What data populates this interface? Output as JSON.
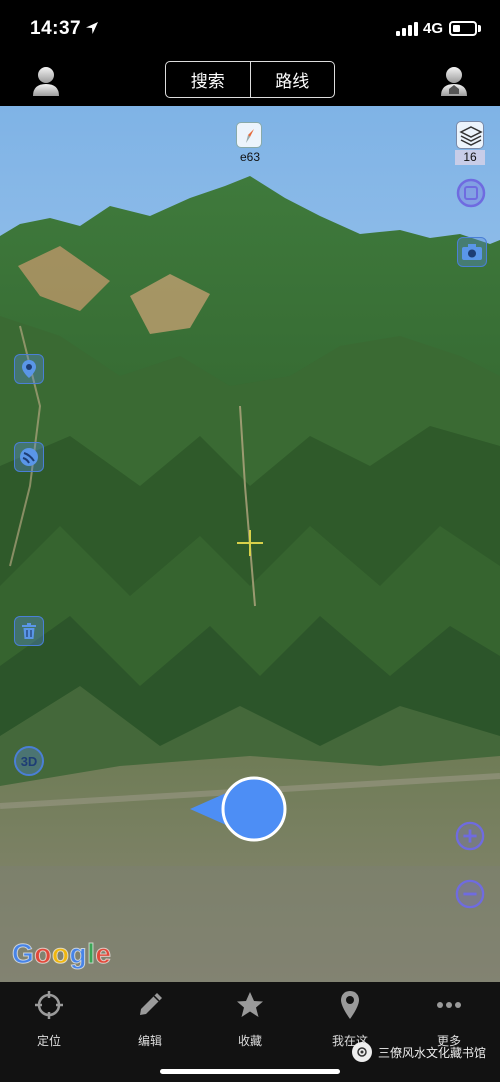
{
  "status_bar": {
    "time": "14:37",
    "network": "4G",
    "location_icon": "location-arrow-icon",
    "signal_icon": "cellular-signal-icon",
    "battery_icon": "battery-low-icon",
    "battery_level": 0.25
  },
  "top_nav": {
    "left_icon": "user-profile-icon",
    "right_icon": "user-home-icon",
    "segments": [
      "搜索",
      "路线"
    ]
  },
  "map": {
    "compass_label": "e63",
    "zoom_level": "16",
    "crosshair_icon": "crosshair-icon",
    "left_tools": [
      {
        "name": "location-pin-icon"
      },
      {
        "name": "track-record-icon"
      },
      {
        "name": "trash-icon"
      },
      {
        "name": "3d-toggle",
        "label": "3D"
      }
    ],
    "right_tools": [
      {
        "name": "layers-icon"
      },
      {
        "name": "square-frame-icon"
      },
      {
        "name": "camera-icon"
      },
      {
        "name": "zoom-in-icon"
      },
      {
        "name": "zoom-out-icon"
      }
    ],
    "attribution": "Google",
    "colors": {
      "accent": "#4a7fd6",
      "position_marker": "#4d8ef5",
      "crosshair": "#d8d04a",
      "zoom_btn": "#6f6be0"
    }
  },
  "tab_bar": {
    "tabs": [
      {
        "label": "定位",
        "icon": "crosshair-target-icon"
      },
      {
        "label": "编辑",
        "icon": "pencil-icon"
      },
      {
        "label": "收藏",
        "icon": "star-icon"
      },
      {
        "label": "我在这",
        "icon": "map-pin-icon"
      },
      {
        "label": "更多",
        "icon": "more-dots-icon"
      }
    ]
  },
  "watermark": {
    "text": "三僚风水文化藏书馆",
    "icon": "wechat-channel-icon"
  }
}
